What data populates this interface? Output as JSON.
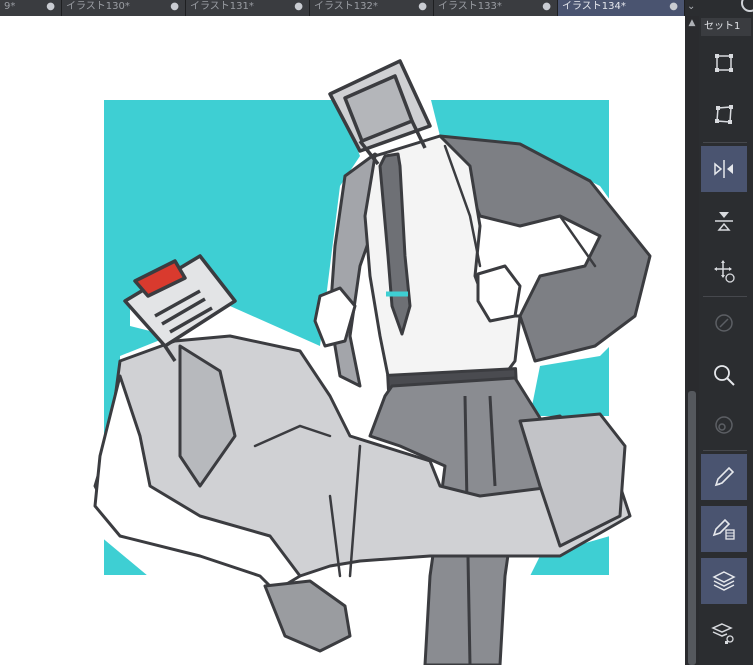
{
  "tabs": [
    {
      "label": "9*",
      "active": false
    },
    {
      "label": "イラスト130*",
      "active": false
    },
    {
      "label": "イラスト131*",
      "active": false
    },
    {
      "label": "イラスト132*",
      "active": false
    },
    {
      "label": "イラスト133*",
      "active": false
    },
    {
      "label": "イラスト134*",
      "active": true
    }
  ],
  "tab_close_glyph": "●",
  "tab_overflow_glyph": "⌄",
  "panel": {
    "set_label": "セット1",
    "tools": [
      {
        "name": "transform-rect-icon",
        "selected": false
      },
      {
        "name": "free-transform-icon",
        "selected": false
      },
      {
        "name": "flip-horizontal-icon",
        "selected": true
      },
      {
        "name": "flip-vertical-icon",
        "selected": false
      },
      {
        "name": "move-layer-icon",
        "selected": false
      },
      {
        "name": "navigator-icon",
        "selected": false
      },
      {
        "name": "zoom-icon",
        "selected": false
      },
      {
        "name": "sub-view-icon",
        "selected": false
      },
      {
        "name": "pen-icon",
        "selected": true
      },
      {
        "name": "pen-layer-icon",
        "selected": true
      },
      {
        "name": "layer-stack-icon",
        "selected": true
      },
      {
        "name": "layer-properties-icon",
        "selected": false
      }
    ]
  },
  "artwork": {
    "background_color": "#3ecfd3",
    "accent_red": "#d93a2e",
    "ink_color": "#3b3c40",
    "description_name": "illustration-canvas"
  }
}
